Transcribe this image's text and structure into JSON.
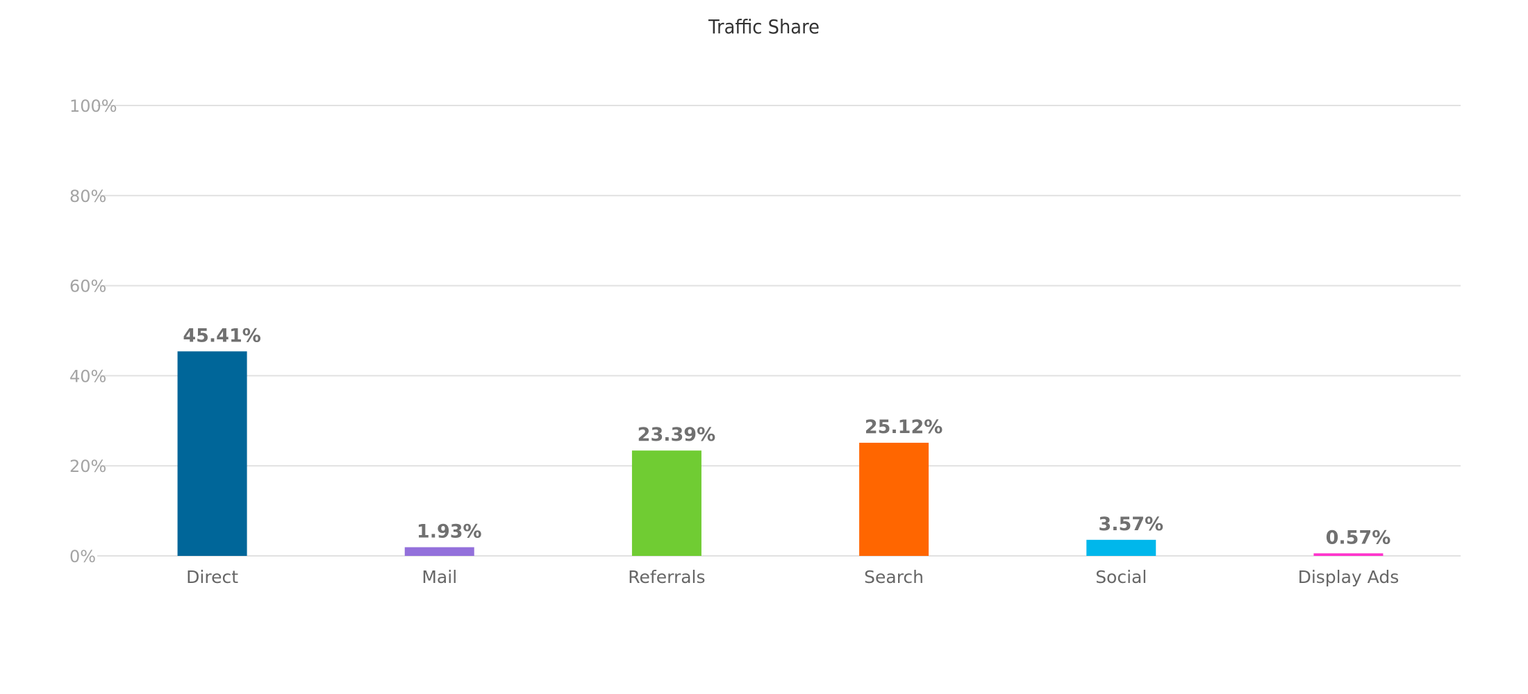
{
  "chart_data": {
    "type": "bar",
    "title": "Traffic Share",
    "xlabel": "",
    "ylabel": "",
    "categories": [
      "Direct",
      "Mail",
      "Referrals",
      "Search",
      "Social",
      "Display Ads"
    ],
    "values": [
      45.41,
      1.93,
      23.39,
      25.12,
      3.57,
      0.57
    ],
    "data_labels": [
      "45.41%",
      "1.93%",
      "23.39%",
      "25.12%",
      "3.57%",
      "0.57%"
    ],
    "colors": [
      "#006699",
      "#9370db",
      "#70cc33",
      "#ff6600",
      "#00b7eb",
      "#ff33cc"
    ],
    "ylim": [
      0,
      100
    ],
    "yticks": [
      0,
      20,
      40,
      60,
      80,
      100
    ],
    "ytick_labels": [
      "0%",
      "20%",
      "40%",
      "60%",
      "80%",
      "100%"
    ],
    "grid": true,
    "legend": "none"
  }
}
